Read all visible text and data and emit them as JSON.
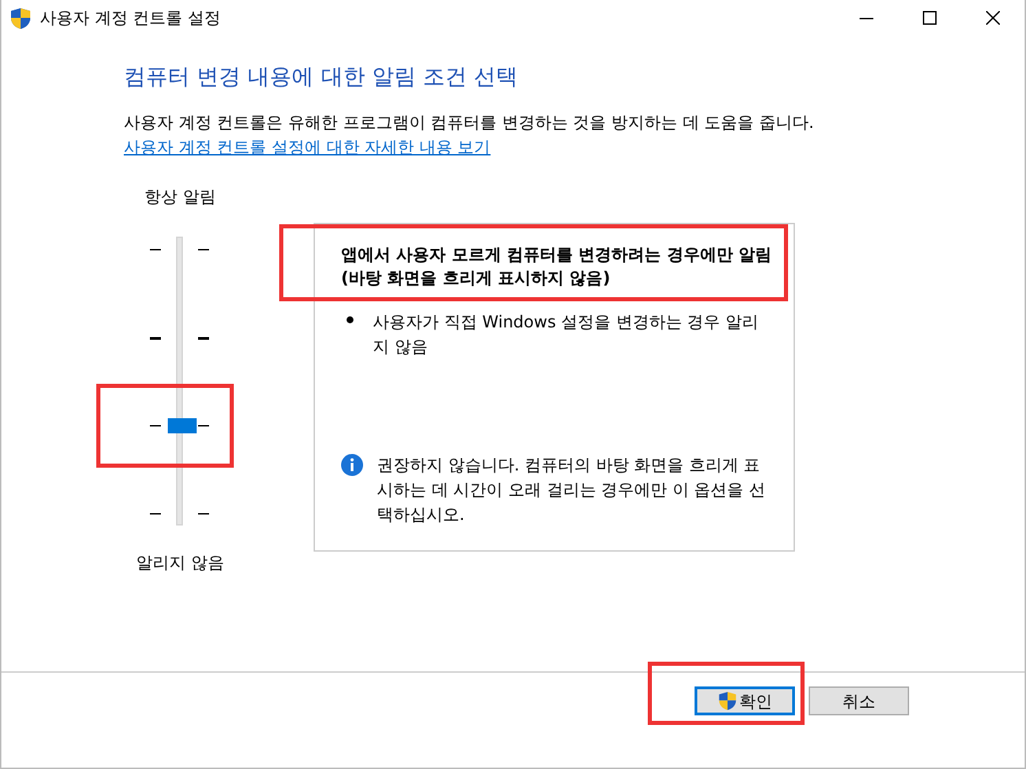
{
  "window": {
    "title": "사용자 계정 컨트롤 설정"
  },
  "heading": "컴퓨터 변경 내용에 대한 알림 조건 선택",
  "intro": "사용자 계정 컨트롤은 유해한 프로그램이 컴퓨터를 변경하는 것을 방지하는 데 도움을 줍니다.",
  "link": "사용자 계정 컨트롤 설정에 대한 자세한 내용 보기",
  "slider": {
    "top_label": "항상 알림",
    "bottom_label": "알리지 않음",
    "level": 0.3333,
    "highlighted": true
  },
  "panel": {
    "title": "앱에서 사용자 모르게 컴퓨터를 변경하려는 경우에만 알림\n(바탕 화면을 흐리게 표시하지 않음)",
    "title_highlighted": true,
    "bullets": [
      "사용자가 직접 Windows 설정을 변경하는 경우 알리지 않음"
    ],
    "note": "권장하지 않습니다. 컴퓨터의 바탕 화면을 흐리게 표시하는 데 시간이 오래 걸리는 경우에만 이 옵션을 선택하십시오."
  },
  "buttons": [
    {
      "label": "확인",
      "shield": true,
      "default": true,
      "highlighted": true
    },
    {
      "label": "취소",
      "shield": false,
      "default": false,
      "highlighted": false
    }
  ]
}
